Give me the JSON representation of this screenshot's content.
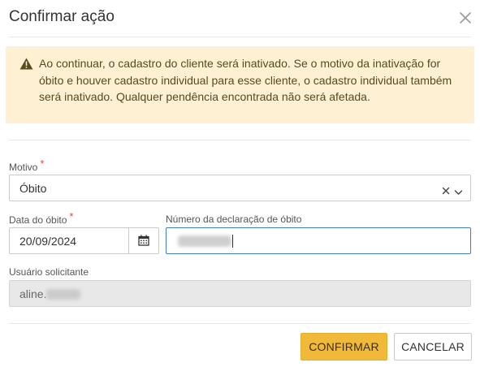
{
  "dialog": {
    "title": "Confirmar ação",
    "close_icon": "close-icon"
  },
  "alert": {
    "icon": "warning-icon",
    "message": "Ao continuar, o cadastro do cliente será inativado. Se o motivo da inativação for óbito e houver cadastro individual para esse cliente, o cadastro individual também será inativado. Qualquer pendência encontrada não será afetada."
  },
  "form": {
    "motivo": {
      "label": "Motivo",
      "required_mark": "*",
      "value": "Óbito"
    },
    "data_obito": {
      "label": "Data do óbito",
      "required_mark": "*",
      "value": "20/09/2024",
      "icon": "calendar-icon"
    },
    "numero_declaracao": {
      "label": "Número da declaração de óbito"
    },
    "usuario": {
      "label": "Usuário solicitante",
      "value": "aline."
    }
  },
  "buttons": {
    "confirm": "CONFIRMAR",
    "cancel": "CANCELAR"
  },
  "colors": {
    "alert_bg": "#fdf0d3",
    "confirm_bg": "#f0b93a",
    "required": "#e04a3b",
    "focus_border": "#3f7fbf"
  }
}
